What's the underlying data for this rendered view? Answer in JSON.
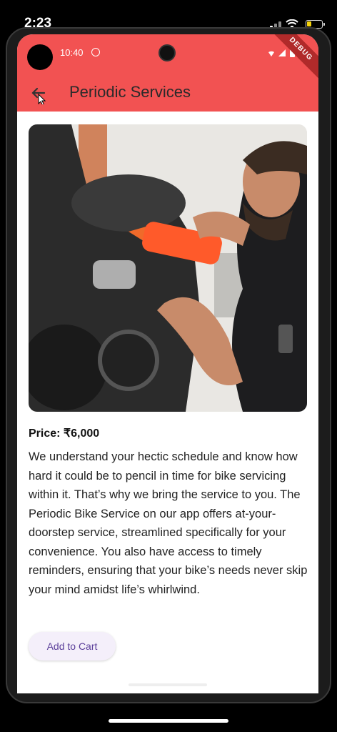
{
  "ios_status": {
    "time": "2:23"
  },
  "android_status": {
    "time": "10:40",
    "debug_badge": "DEBUG"
  },
  "app_bar": {
    "title": "Periodic Services",
    "color": "#f25252"
  },
  "service": {
    "image": "bike-mechanic-image",
    "price": "Price: ₹6,000",
    "description": "We understand your hectic schedule and know how hard it could be to pencil in time for bike servicing within it. That’s why we bring the service to you. The Periodic Bike Service on our app offers at-your-doorstep service, streamlined specifically for your convenience. You also have access to timely reminders, ensuring that your bike’s needs never skip your mind amidst life’s whirlwind.",
    "add_to_cart_label": "Add to Cart"
  }
}
